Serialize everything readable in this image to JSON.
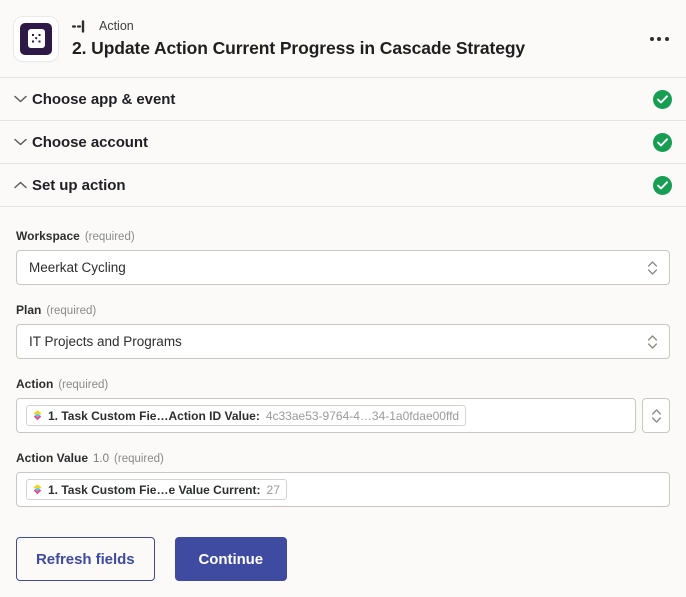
{
  "header": {
    "app_icon_name": "zapier-app-icon",
    "step_icon_name": "action-step-icon",
    "kicker": "Action",
    "title": "2. Update Action Current Progress in Cascade Strategy",
    "more_menu_label": "More options"
  },
  "accordion": [
    {
      "label": "Choose app & event",
      "state": "collapsed",
      "status": "complete",
      "chevron": "chevron-down-icon"
    },
    {
      "label": "Choose account",
      "state": "collapsed",
      "status": "complete",
      "chevron": "chevron-down-icon"
    },
    {
      "label": "Set up action",
      "state": "expanded",
      "status": "complete",
      "chevron": "chevron-up-icon"
    }
  ],
  "fields": {
    "workspace": {
      "label": "Workspace",
      "required_text": "(required)",
      "value": "Meerkat Cycling"
    },
    "plan": {
      "label": "Plan",
      "required_text": "(required)",
      "value": "IT Projects and Programs"
    },
    "action": {
      "label": "Action",
      "required_text": "(required)",
      "token_label": "1. Task Custom Fie…Action ID Value:",
      "token_value": "4c33ae53-9764-4…34-1a0fdae00ffd"
    },
    "action_value": {
      "label": "Action Value",
      "version": "1.0",
      "required_text": "(required)",
      "token_label": "1. Task Custom Fie…e Value Current:",
      "token_value": "27"
    }
  },
  "buttons": {
    "refresh": "Refresh fields",
    "continue": "Continue"
  },
  "colors": {
    "accent": "#3f4ba0",
    "success": "#189e52",
    "app_icon": "#2e1a47",
    "page_bg": "#fbfaf9"
  }
}
